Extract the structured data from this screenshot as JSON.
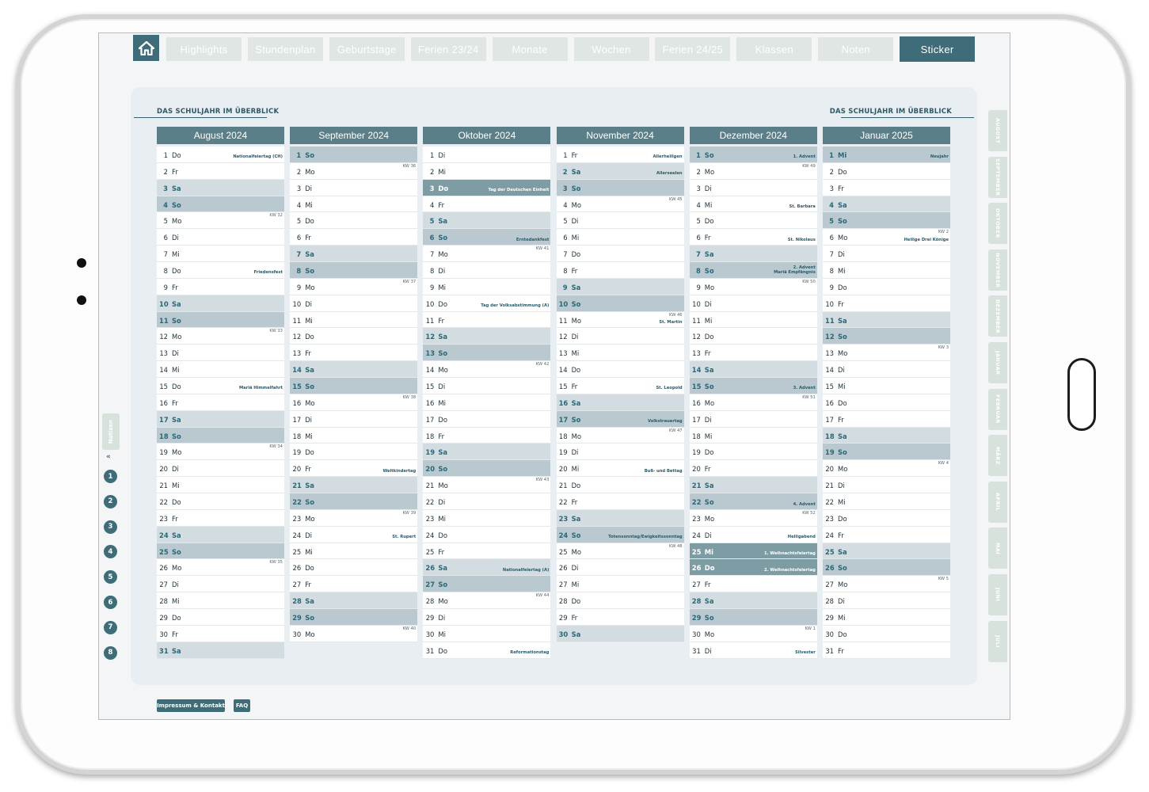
{
  "nav": {
    "home_icon": "home-icon",
    "tabs": [
      {
        "label": "Highlights",
        "active": false
      },
      {
        "label": "Stundenplan",
        "active": false
      },
      {
        "label": "Geburtstage",
        "active": false
      },
      {
        "label": "Ferien 23/24",
        "active": false
      },
      {
        "label": "Monate",
        "active": false
      },
      {
        "label": "Wochen",
        "active": false
      },
      {
        "label": "Ferien 24/25",
        "active": false
      },
      {
        "label": "Klassen",
        "active": false
      },
      {
        "label": "Noten",
        "active": false
      },
      {
        "label": "Sticker",
        "active": true
      }
    ]
  },
  "overview": {
    "title_left": "DAS SCHULJAHR IM ÜBERBLICK",
    "title_right": "DAS SCHULJAHR IM ÜBERBLICK"
  },
  "colors": {
    "accent": "#3e6c78",
    "header": "#5b7f88",
    "saturday": "#d3dde1",
    "sunday": "#b9c9cf",
    "holiday": "#7e9ca3"
  },
  "months": [
    {
      "title": "August 2024",
      "days": [
        {
          "d": "1",
          "wd": "Do",
          "note": "Nationalfeiertag (CH)"
        },
        {
          "d": "2",
          "wd": "Fr"
        },
        {
          "d": "3",
          "wd": "Sa",
          "type": "sa"
        },
        {
          "d": "4",
          "wd": "So",
          "type": "so"
        },
        {
          "d": "5",
          "wd": "Mo",
          "kw": "KW 32"
        },
        {
          "d": "6",
          "wd": "Di"
        },
        {
          "d": "7",
          "wd": "Mi"
        },
        {
          "d": "8",
          "wd": "Do",
          "note": "Friedensfest"
        },
        {
          "d": "9",
          "wd": "Fr"
        },
        {
          "d": "10",
          "wd": "Sa",
          "type": "sa"
        },
        {
          "d": "11",
          "wd": "So",
          "type": "so"
        },
        {
          "d": "12",
          "wd": "Mo",
          "kw": "KW 33"
        },
        {
          "d": "13",
          "wd": "Di"
        },
        {
          "d": "14",
          "wd": "Mi"
        },
        {
          "d": "15",
          "wd": "Do",
          "note": "Mariä Himmelfahrt"
        },
        {
          "d": "16",
          "wd": "Fr"
        },
        {
          "d": "17",
          "wd": "Sa",
          "type": "sa"
        },
        {
          "d": "18",
          "wd": "So",
          "type": "so"
        },
        {
          "d": "19",
          "wd": "Mo",
          "kw": "KW 34"
        },
        {
          "d": "20",
          "wd": "Di"
        },
        {
          "d": "21",
          "wd": "Mi"
        },
        {
          "d": "22",
          "wd": "Do"
        },
        {
          "d": "23",
          "wd": "Fr"
        },
        {
          "d": "24",
          "wd": "Sa",
          "type": "sa"
        },
        {
          "d": "25",
          "wd": "So",
          "type": "so"
        },
        {
          "d": "26",
          "wd": "Mo",
          "kw": "KW 35"
        },
        {
          "d": "27",
          "wd": "Di"
        },
        {
          "d": "28",
          "wd": "Mi"
        },
        {
          "d": "29",
          "wd": "Do"
        },
        {
          "d": "30",
          "wd": "Fr"
        },
        {
          "d": "31",
          "wd": "Sa",
          "type": "sa"
        }
      ]
    },
    {
      "title": "September 2024",
      "days": [
        {
          "d": "1",
          "wd": "So",
          "type": "so"
        },
        {
          "d": "2",
          "wd": "Mo",
          "kw": "KW 36"
        },
        {
          "d": "3",
          "wd": "Di"
        },
        {
          "d": "4",
          "wd": "Mi"
        },
        {
          "d": "5",
          "wd": "Do"
        },
        {
          "d": "6",
          "wd": "Fr"
        },
        {
          "d": "7",
          "wd": "Sa",
          "type": "sa"
        },
        {
          "d": "8",
          "wd": "So",
          "type": "so"
        },
        {
          "d": "9",
          "wd": "Mo",
          "kw": "KW 37"
        },
        {
          "d": "10",
          "wd": "Di"
        },
        {
          "d": "11",
          "wd": "Mi"
        },
        {
          "d": "12",
          "wd": "Do"
        },
        {
          "d": "13",
          "wd": "Fr"
        },
        {
          "d": "14",
          "wd": "Sa",
          "type": "sa"
        },
        {
          "d": "15",
          "wd": "So",
          "type": "so"
        },
        {
          "d": "16",
          "wd": "Mo",
          "kw": "KW 38"
        },
        {
          "d": "17",
          "wd": "Di"
        },
        {
          "d": "18",
          "wd": "Mi"
        },
        {
          "d": "19",
          "wd": "Do"
        },
        {
          "d": "20",
          "wd": "Fr",
          "note": "Weltkindertag"
        },
        {
          "d": "21",
          "wd": "Sa",
          "type": "sa"
        },
        {
          "d": "22",
          "wd": "So",
          "type": "so"
        },
        {
          "d": "23",
          "wd": "Mo",
          "kw": "KW 39"
        },
        {
          "d": "24",
          "wd": "Di",
          "note": "St. Rupert"
        },
        {
          "d": "25",
          "wd": "Mi"
        },
        {
          "d": "26",
          "wd": "Do"
        },
        {
          "d": "27",
          "wd": "Fr"
        },
        {
          "d": "28",
          "wd": "Sa",
          "type": "sa"
        },
        {
          "d": "29",
          "wd": "So",
          "type": "so"
        },
        {
          "d": "30",
          "wd": "Mo",
          "kw": "KW 40"
        }
      ]
    },
    {
      "title": "Oktober 2024",
      "days": [
        {
          "d": "1",
          "wd": "Di"
        },
        {
          "d": "2",
          "wd": "Mi"
        },
        {
          "d": "3",
          "wd": "Do",
          "type": "hol",
          "note": "Tag der Deutschen Einheit"
        },
        {
          "d": "4",
          "wd": "Fr"
        },
        {
          "d": "5",
          "wd": "Sa",
          "type": "sa"
        },
        {
          "d": "6",
          "wd": "So",
          "type": "so",
          "note": "Erntedankfest"
        },
        {
          "d": "7",
          "wd": "Mo",
          "kw": "KW 41"
        },
        {
          "d": "8",
          "wd": "Di"
        },
        {
          "d": "9",
          "wd": "Mi"
        },
        {
          "d": "10",
          "wd": "Do",
          "note": "Tag der Volksabstimmung (A)"
        },
        {
          "d": "11",
          "wd": "Fr"
        },
        {
          "d": "12",
          "wd": "Sa",
          "type": "sa"
        },
        {
          "d": "13",
          "wd": "So",
          "type": "so"
        },
        {
          "d": "14",
          "wd": "Mo",
          "kw": "KW 42"
        },
        {
          "d": "15",
          "wd": "Di"
        },
        {
          "d": "16",
          "wd": "Mi"
        },
        {
          "d": "17",
          "wd": "Do"
        },
        {
          "d": "18",
          "wd": "Fr"
        },
        {
          "d": "19",
          "wd": "Sa",
          "type": "sa"
        },
        {
          "d": "20",
          "wd": "So",
          "type": "so"
        },
        {
          "d": "21",
          "wd": "Mo",
          "kw": "KW 43"
        },
        {
          "d": "22",
          "wd": "Di"
        },
        {
          "d": "23",
          "wd": "Mi"
        },
        {
          "d": "24",
          "wd": "Do"
        },
        {
          "d": "25",
          "wd": "Fr"
        },
        {
          "d": "26",
          "wd": "Sa",
          "type": "sa",
          "note": "Nationalfeiertag (A)"
        },
        {
          "d": "27",
          "wd": "So",
          "type": "so"
        },
        {
          "d": "28",
          "wd": "Mo",
          "kw": "KW 44"
        },
        {
          "d": "29",
          "wd": "Di"
        },
        {
          "d": "30",
          "wd": "Mi"
        },
        {
          "d": "31",
          "wd": "Do",
          "note": "Reformationstag"
        }
      ]
    },
    {
      "title": "November 2024",
      "days": [
        {
          "d": "1",
          "wd": "Fr",
          "note": "Allerheiligen"
        },
        {
          "d": "2",
          "wd": "Sa",
          "type": "sa",
          "note": "Allerseelen"
        },
        {
          "d": "3",
          "wd": "So",
          "type": "so"
        },
        {
          "d": "4",
          "wd": "Mo",
          "kw": "KW 45"
        },
        {
          "d": "5",
          "wd": "Di"
        },
        {
          "d": "6",
          "wd": "Mi"
        },
        {
          "d": "7",
          "wd": "Do"
        },
        {
          "d": "8",
          "wd": "Fr"
        },
        {
          "d": "9",
          "wd": "Sa",
          "type": "sa"
        },
        {
          "d": "10",
          "wd": "So",
          "type": "so"
        },
        {
          "d": "11",
          "wd": "Mo",
          "kw": "KW 46",
          "note": "St. Martin"
        },
        {
          "d": "12",
          "wd": "Di"
        },
        {
          "d": "13",
          "wd": "Mi"
        },
        {
          "d": "14",
          "wd": "Do"
        },
        {
          "d": "15",
          "wd": "Fr",
          "note": "St. Leopold"
        },
        {
          "d": "16",
          "wd": "Sa",
          "type": "sa"
        },
        {
          "d": "17",
          "wd": "So",
          "type": "so",
          "note": "Volkstrauertag"
        },
        {
          "d": "18",
          "wd": "Mo",
          "kw": "KW 47"
        },
        {
          "d": "19",
          "wd": "Di"
        },
        {
          "d": "20",
          "wd": "Mi",
          "note": "Buß- und Bettag"
        },
        {
          "d": "21",
          "wd": "Do"
        },
        {
          "d": "22",
          "wd": "Fr"
        },
        {
          "d": "23",
          "wd": "Sa",
          "type": "sa"
        },
        {
          "d": "24",
          "wd": "So",
          "type": "so",
          "note": "Totensonntag/Ewigkeitssonntag"
        },
        {
          "d": "25",
          "wd": "Mo",
          "kw": "KW 48"
        },
        {
          "d": "26",
          "wd": "Di"
        },
        {
          "d": "27",
          "wd": "Mi"
        },
        {
          "d": "28",
          "wd": "Do"
        },
        {
          "d": "29",
          "wd": "Fr"
        },
        {
          "d": "30",
          "wd": "Sa",
          "type": "sa"
        }
      ]
    },
    {
      "title": "Dezember 2024",
      "days": [
        {
          "d": "1",
          "wd": "So",
          "type": "so",
          "note": "1. Advent"
        },
        {
          "d": "2",
          "wd": "Mo",
          "kw": "KW 49"
        },
        {
          "d": "3",
          "wd": "Di"
        },
        {
          "d": "4",
          "wd": "Mi",
          "note": "St. Barbara"
        },
        {
          "d": "5",
          "wd": "Do"
        },
        {
          "d": "6",
          "wd": "Fr",
          "note": "St. Nikolaus"
        },
        {
          "d": "7",
          "wd": "Sa",
          "type": "sa"
        },
        {
          "d": "8",
          "wd": "So",
          "type": "so",
          "note": "2. Advent\nMariä Empfängnis"
        },
        {
          "d": "9",
          "wd": "Mo",
          "kw": "KW 50"
        },
        {
          "d": "10",
          "wd": "Di"
        },
        {
          "d": "11",
          "wd": "Mi"
        },
        {
          "d": "12",
          "wd": "Do"
        },
        {
          "d": "13",
          "wd": "Fr"
        },
        {
          "d": "14",
          "wd": "Sa",
          "type": "sa"
        },
        {
          "d": "15",
          "wd": "So",
          "type": "so",
          "note": "3. Advent"
        },
        {
          "d": "16",
          "wd": "Mo",
          "kw": "KW 51"
        },
        {
          "d": "17",
          "wd": "Di"
        },
        {
          "d": "18",
          "wd": "Mi"
        },
        {
          "d": "19",
          "wd": "Do"
        },
        {
          "d": "20",
          "wd": "Fr"
        },
        {
          "d": "21",
          "wd": "Sa",
          "type": "sa"
        },
        {
          "d": "22",
          "wd": "So",
          "type": "so",
          "note": "4. Advent"
        },
        {
          "d": "23",
          "wd": "Mo",
          "kw": "KW 52"
        },
        {
          "d": "24",
          "wd": "Di",
          "note": "Heiligabend"
        },
        {
          "d": "25",
          "wd": "Mi",
          "type": "hol",
          "note": "1. Weihnachtsfeiertag"
        },
        {
          "d": "26",
          "wd": "Do",
          "type": "hol",
          "note": "2. Weihnachtsfeiertag"
        },
        {
          "d": "27",
          "wd": "Fr"
        },
        {
          "d": "28",
          "wd": "Sa",
          "type": "sa"
        },
        {
          "d": "29",
          "wd": "So",
          "type": "so"
        },
        {
          "d": "30",
          "wd": "Mo",
          "kw": "KW 1"
        },
        {
          "d": "31",
          "wd": "Di",
          "note": "Silvester"
        }
      ]
    },
    {
      "title": "Januar 2025",
      "days": [
        {
          "d": "1",
          "wd": "Mi",
          "type": "so",
          "note": "Neujahr"
        },
        {
          "d": "2",
          "wd": "Do"
        },
        {
          "d": "3",
          "wd": "Fr"
        },
        {
          "d": "4",
          "wd": "Sa",
          "type": "sa"
        },
        {
          "d": "5",
          "wd": "So",
          "type": "so"
        },
        {
          "d": "6",
          "wd": "Mo",
          "kw": "KW 2",
          "note": "Heilige Drei Könige"
        },
        {
          "d": "7",
          "wd": "Di"
        },
        {
          "d": "8",
          "wd": "Mi"
        },
        {
          "d": "9",
          "wd": "Do"
        },
        {
          "d": "10",
          "wd": "Fr"
        },
        {
          "d": "11",
          "wd": "Sa",
          "type": "sa"
        },
        {
          "d": "12",
          "wd": "So",
          "type": "so"
        },
        {
          "d": "13",
          "wd": "Mo",
          "kw": "KW 3"
        },
        {
          "d": "14",
          "wd": "Di"
        },
        {
          "d": "15",
          "wd": "Mi"
        },
        {
          "d": "16",
          "wd": "Do"
        },
        {
          "d": "17",
          "wd": "Fr"
        },
        {
          "d": "18",
          "wd": "Sa",
          "type": "sa"
        },
        {
          "d": "19",
          "wd": "So",
          "type": "so"
        },
        {
          "d": "20",
          "wd": "Mo",
          "kw": "KW 4"
        },
        {
          "d": "21",
          "wd": "Di"
        },
        {
          "d": "22",
          "wd": "Mi"
        },
        {
          "d": "23",
          "wd": "Do"
        },
        {
          "d": "24",
          "wd": "Fr"
        },
        {
          "d": "25",
          "wd": "Sa",
          "type": "sa"
        },
        {
          "d": "26",
          "wd": "So",
          "type": "so"
        },
        {
          "d": "27",
          "wd": "Mo",
          "kw": "KW 5"
        },
        {
          "d": "28",
          "wd": "Di"
        },
        {
          "d": "29",
          "wd": "Mi"
        },
        {
          "d": "30",
          "wd": "Do"
        },
        {
          "d": "31",
          "wd": "Fr"
        }
      ]
    }
  ],
  "left_rail": {
    "notes_label": "Notizen",
    "chevron_icon": "chevron-double-down-icon",
    "chevron_glyph": "«",
    "numbers": [
      "1",
      "2",
      "3",
      "4",
      "5",
      "6",
      "7",
      "8"
    ]
  },
  "right_rail": {
    "tabs": [
      "AUGUST",
      "SEPTEMBER",
      "OKTOBER",
      "NOVEMBER",
      "DEZEMBER",
      "JANUAR",
      "FEBRUAR",
      "MÄRZ",
      "APRIL",
      "MAI",
      "JUNI",
      "JULI"
    ]
  },
  "footer": {
    "impressum_label": "Impressum & Kontakt",
    "faq_label": "FAQ"
  }
}
